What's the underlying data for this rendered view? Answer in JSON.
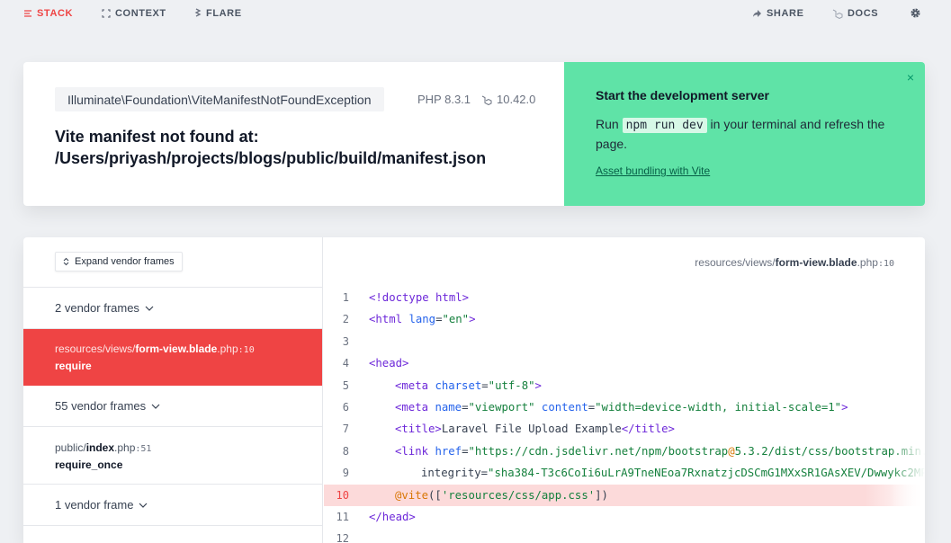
{
  "nav": {
    "stack": "STACK",
    "context": "CONTEXT",
    "flare": "FLARE",
    "share": "SHARE",
    "docs": "DOCS"
  },
  "error": {
    "exception_class": "Illuminate\\Foundation\\ViteManifestNotFoundException",
    "php_version": "PHP 8.3.1",
    "laravel_version": "10.42.0",
    "message_line1": "Vite manifest not found at:",
    "message_line2": "/Users/priyash/projects/blogs/public/build/manifest.json"
  },
  "solution": {
    "title": "Start the development server",
    "body_prefix": "Run ",
    "command": "npm run dev",
    "body_suffix": " in your terminal and refresh the page.",
    "link": "Asset bundling with Vite",
    "close_icon": "×"
  },
  "frames": {
    "expand_label": "Expand vendor frames",
    "items": [
      {
        "type": "vendor",
        "label": "2 vendor frames"
      },
      {
        "type": "app",
        "dir": "resources/views/",
        "file": "form-view.blade",
        "ext": ".php",
        "line": ":10",
        "method": "require",
        "active": true
      },
      {
        "type": "vendor",
        "label": "55 vendor frames"
      },
      {
        "type": "app",
        "dir": "public/",
        "file": "index",
        "ext": ".php",
        "line": ":51",
        "method": "require_once",
        "active": false
      },
      {
        "type": "vendor",
        "label": "1 vendor frame"
      }
    ]
  },
  "code": {
    "file_dir": "resources/views/",
    "file_name": "form-view.blade",
    "file_ext": ".php",
    "file_line": ":10",
    "highlight_line": 10
  },
  "colors": {
    "accent": "#ef4444",
    "solution_bg": "#5fe3a7"
  }
}
